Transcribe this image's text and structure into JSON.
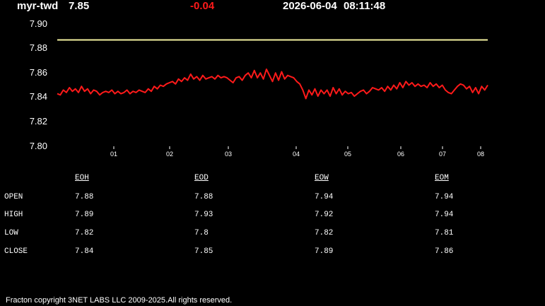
{
  "header": {
    "symbol": "myr-twd",
    "last": "7.85",
    "change": "-0.04",
    "date": "2026-06-04",
    "time": "08:11:48"
  },
  "colors": {
    "background": "#000000",
    "text": "#ffffff",
    "change_negative": "#ff1a1a",
    "series_line": "#ff1a1a",
    "reference_line": "#f2f0a0"
  },
  "chart_data": {
    "type": "line",
    "y_ticks": [
      "7.90",
      "7.88",
      "7.86",
      "7.84",
      "7.82",
      "7.80"
    ],
    "x_ticks": [
      "01",
      "02",
      "03",
      "04",
      "05",
      "06",
      "07",
      "08"
    ],
    "ylim": [
      7.8,
      7.9
    ],
    "grid": false,
    "reference_value": 7.887,
    "series": [
      {
        "values": [
          7.843,
          7.842,
          7.846,
          7.844,
          7.848,
          7.845,
          7.847,
          7.844,
          7.849,
          7.845,
          7.847,
          7.843,
          7.846,
          7.845,
          7.842,
          7.844,
          7.845,
          7.844,
          7.846,
          7.843,
          7.845,
          7.843,
          7.844,
          7.846,
          7.843,
          7.845,
          7.844,
          7.846,
          7.845,
          7.844,
          7.847,
          7.845,
          7.849,
          7.847,
          7.85,
          7.849,
          7.851,
          7.852,
          7.853,
          7.851,
          7.855,
          7.853,
          7.856,
          7.854,
          7.859,
          7.855,
          7.857,
          7.854,
          7.858,
          7.855,
          7.856,
          7.857,
          7.855,
          7.858,
          7.856,
          7.857,
          7.856,
          7.854,
          7.852,
          7.856,
          7.857,
          7.854,
          7.858,
          7.86,
          7.856,
          7.862,
          7.856,
          7.86,
          7.855,
          7.863,
          7.858,
          7.853,
          7.86,
          7.854,
          7.861,
          7.855,
          7.858,
          7.857,
          7.856,
          7.853,
          7.851,
          7.846,
          7.839,
          7.846,
          7.842,
          7.847,
          7.841,
          7.846,
          7.843,
          7.846,
          7.841,
          7.848,
          7.843,
          7.847,
          7.842,
          7.845,
          7.843,
          7.844,
          7.841,
          7.843,
          7.845,
          7.846,
          7.843,
          7.845,
          7.848,
          7.847,
          7.846,
          7.848,
          7.845,
          7.849,
          7.846,
          7.85,
          7.847,
          7.852,
          7.848,
          7.853,
          7.85,
          7.852,
          7.849,
          7.851,
          7.849,
          7.85,
          7.848,
          7.852,
          7.849,
          7.851,
          7.848,
          7.85,
          7.846,
          7.844,
          7.843,
          7.846,
          7.849,
          7.851,
          7.85,
          7.847,
          7.849,
          7.844,
          7.848,
          7.843,
          7.849,
          7.846,
          7.85
        ]
      }
    ]
  },
  "table": {
    "columns": [
      "EOH",
      "EOD",
      "EOW",
      "EOM"
    ],
    "rows": [
      {
        "label": "OPEN",
        "values": [
          "7.88",
          "7.88",
          "7.94",
          "7.94"
        ]
      },
      {
        "label": "HIGH",
        "values": [
          "7.89",
          "7.93",
          "7.92",
          "7.94"
        ]
      },
      {
        "label": "LOW",
        "values": [
          "7.82",
          "7.8",
          "7.82",
          "7.81"
        ]
      },
      {
        "label": "CLOSE",
        "values": [
          "7.84",
          "7.85",
          "7.89",
          "7.86"
        ]
      }
    ]
  },
  "footer": "Fracton copyright 3NET LABS LLC 2009-2025.All rights reserved."
}
